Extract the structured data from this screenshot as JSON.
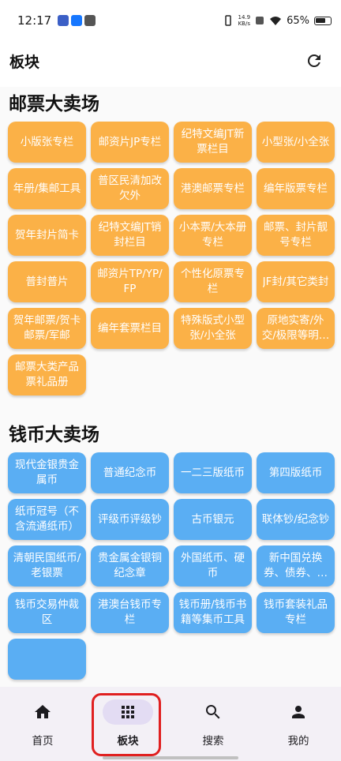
{
  "status": {
    "time": "12:17",
    "net_speed_value": "14.9",
    "net_speed_unit": "KB/s",
    "battery": "65%"
  },
  "header": {
    "title": "板块"
  },
  "sections": [
    {
      "title": "邮票大卖场",
      "color": "#fbb147",
      "items": [
        "小版张专栏",
        "邮资片JP专栏",
        "纪特文编JT新票栏目",
        "小型张/小全张",
        "年册/集邮工具",
        "普区民清加改欠外",
        "港澳邮票专栏",
        "编年版票专栏",
        "贺年封片简卡",
        "纪特文编JT销封栏目",
        "小本票/大本册专栏",
        "邮票、封片靓号专栏",
        "普封普片",
        "邮资片TP/YP/FP",
        "个性化原票专栏",
        "JF封/其它类封",
        "贺年邮票/贺卡邮票/军邮",
        "编年套票栏目",
        "特殊版式小型张/小全张",
        "原地实寄/外交/极限等明信片",
        "邮票大类产品票礼品册"
      ]
    },
    {
      "title": "钱币大卖场",
      "color": "#5aaef3",
      "items": [
        "现代金银贵金属币",
        "普通纪念币",
        "一二三版纸币",
        "第四版纸币",
        "纸币冠号（不含流通纸币）",
        "评级币评级钞",
        "古币银元",
        "联体钞/纪念钞",
        "清朝民国纸币/老银票",
        "贵金属金银铜纪念章",
        "外国纸币、硬币",
        "新中国兑换券、债券、粮票",
        "钱币交易仲裁区",
        "港澳台钱币专栏",
        "钱币册/钱币书籍等集币工具",
        "钱币套装礼品专栏",
        ""
      ]
    }
  ],
  "nav": [
    {
      "label": "首页",
      "icon": "home-icon",
      "active": false
    },
    {
      "label": "板块",
      "icon": "grid-icon",
      "active": true
    },
    {
      "label": "搜索",
      "icon": "search-icon",
      "active": false
    },
    {
      "label": "我的",
      "icon": "person-icon",
      "active": false
    }
  ]
}
